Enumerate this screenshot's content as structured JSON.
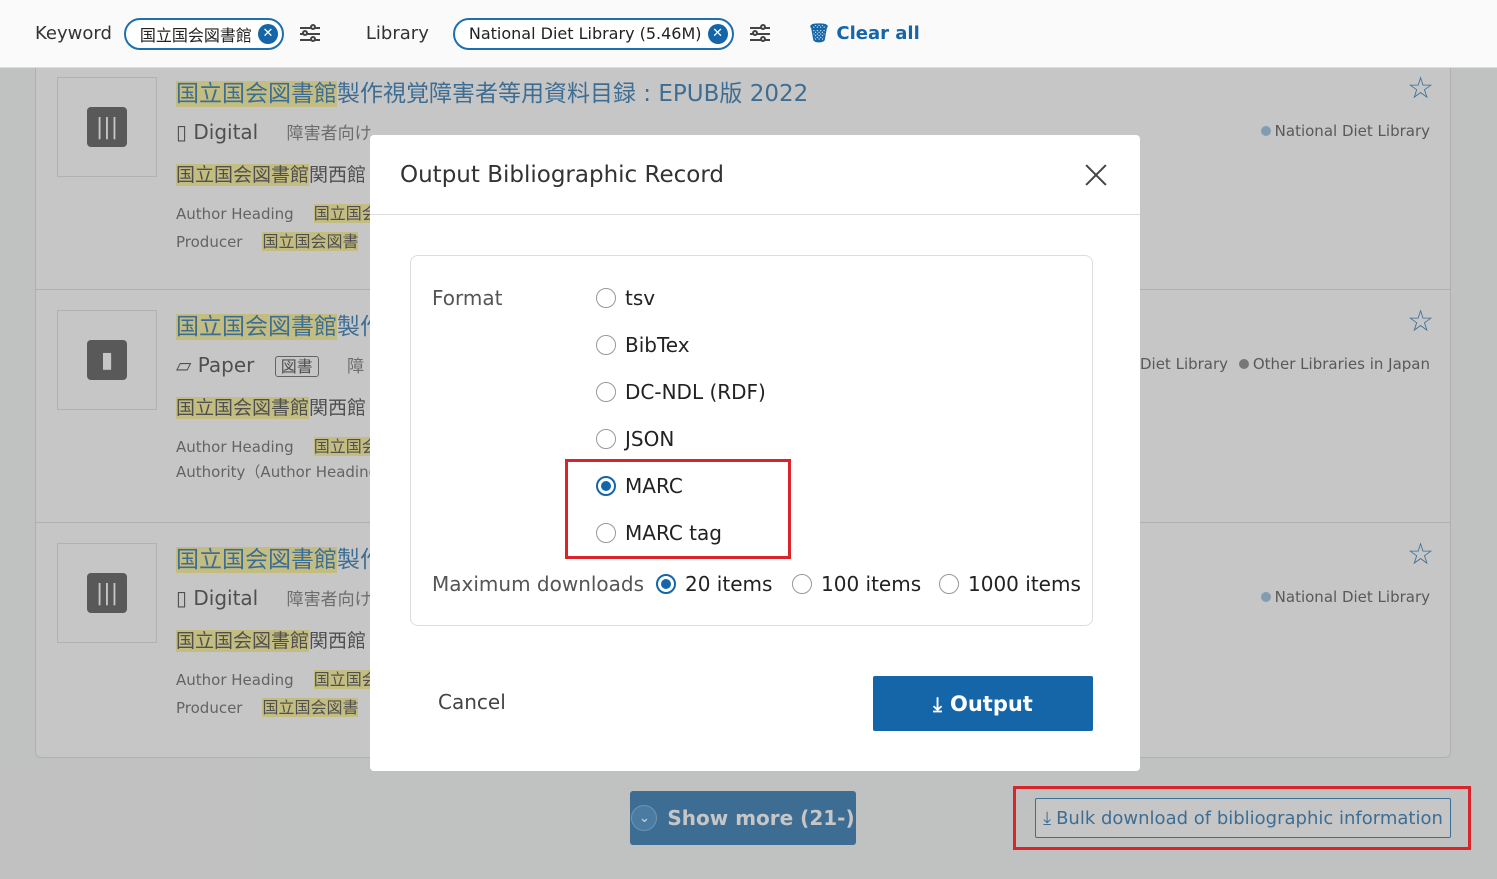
{
  "filters": {
    "keyword_label": "Keyword",
    "keyword_value": "国立国会図書館",
    "library_label": "Library",
    "library_value": "National Diet Library (5.46M)",
    "clear_all": "Clear all"
  },
  "results": [
    {
      "title_hl": "国立国会図書館",
      "title_rest": "製作視覚障害者等用資料目録 : EPUB版 2022",
      "media": "Digital",
      "sub": "障害者向け",
      "publisher_hl": "国立国会図書館",
      "publisher_rest": "関西館",
      "row1_label": "Author Heading",
      "row1_value": "国立国会",
      "row2_label": "Producer",
      "row2_value": "国立国会図書",
      "libs": [
        "National Diet Library"
      ]
    },
    {
      "title_hl": "国立国会図書館",
      "title_rest": "製作",
      "media": "Paper",
      "badge": "図書",
      "sub": "障",
      "publisher_hl": "国立国会図書館",
      "publisher_rest": "関西館",
      "row1_label": "Author Heading",
      "row1_value": "国立国会",
      "row2_label": "Authority（Author Heading",
      "row2_value": "",
      "libs": [
        "al Diet Library",
        "Other Libraries in Japan"
      ]
    },
    {
      "title_hl": "国立国会図書館",
      "title_rest": "製作",
      "media": "Digital",
      "sub": "障害者向け",
      "publisher_hl": "国立国会図書館",
      "publisher_rest": "関西館",
      "row1_label": "Author Heading",
      "row1_value": "国立国会",
      "row2_label": "Producer",
      "row2_value": "国立国会図書",
      "libs": [
        "National Diet Library"
      ]
    }
  ],
  "show_more": "Show more (21-)",
  "bulk_download": "Bulk download of bibliographic information",
  "modal": {
    "title": "Output Bibliographic Record",
    "format_label": "Format",
    "formats": [
      "tsv",
      "BibTex",
      "DC-NDL (RDF)",
      "JSON",
      "MARC",
      "MARC tag"
    ],
    "selected_format": "MARC",
    "max_label": "Maximum downloads",
    "max_options": [
      "20 items",
      "100 items",
      "1000 items"
    ],
    "selected_max": "20 items",
    "cancel": "Cancel",
    "output": "Output"
  },
  "colors": {
    "accent": "#1566a8",
    "highlight": "#fbef8a",
    "annotation": "#d9242b"
  }
}
